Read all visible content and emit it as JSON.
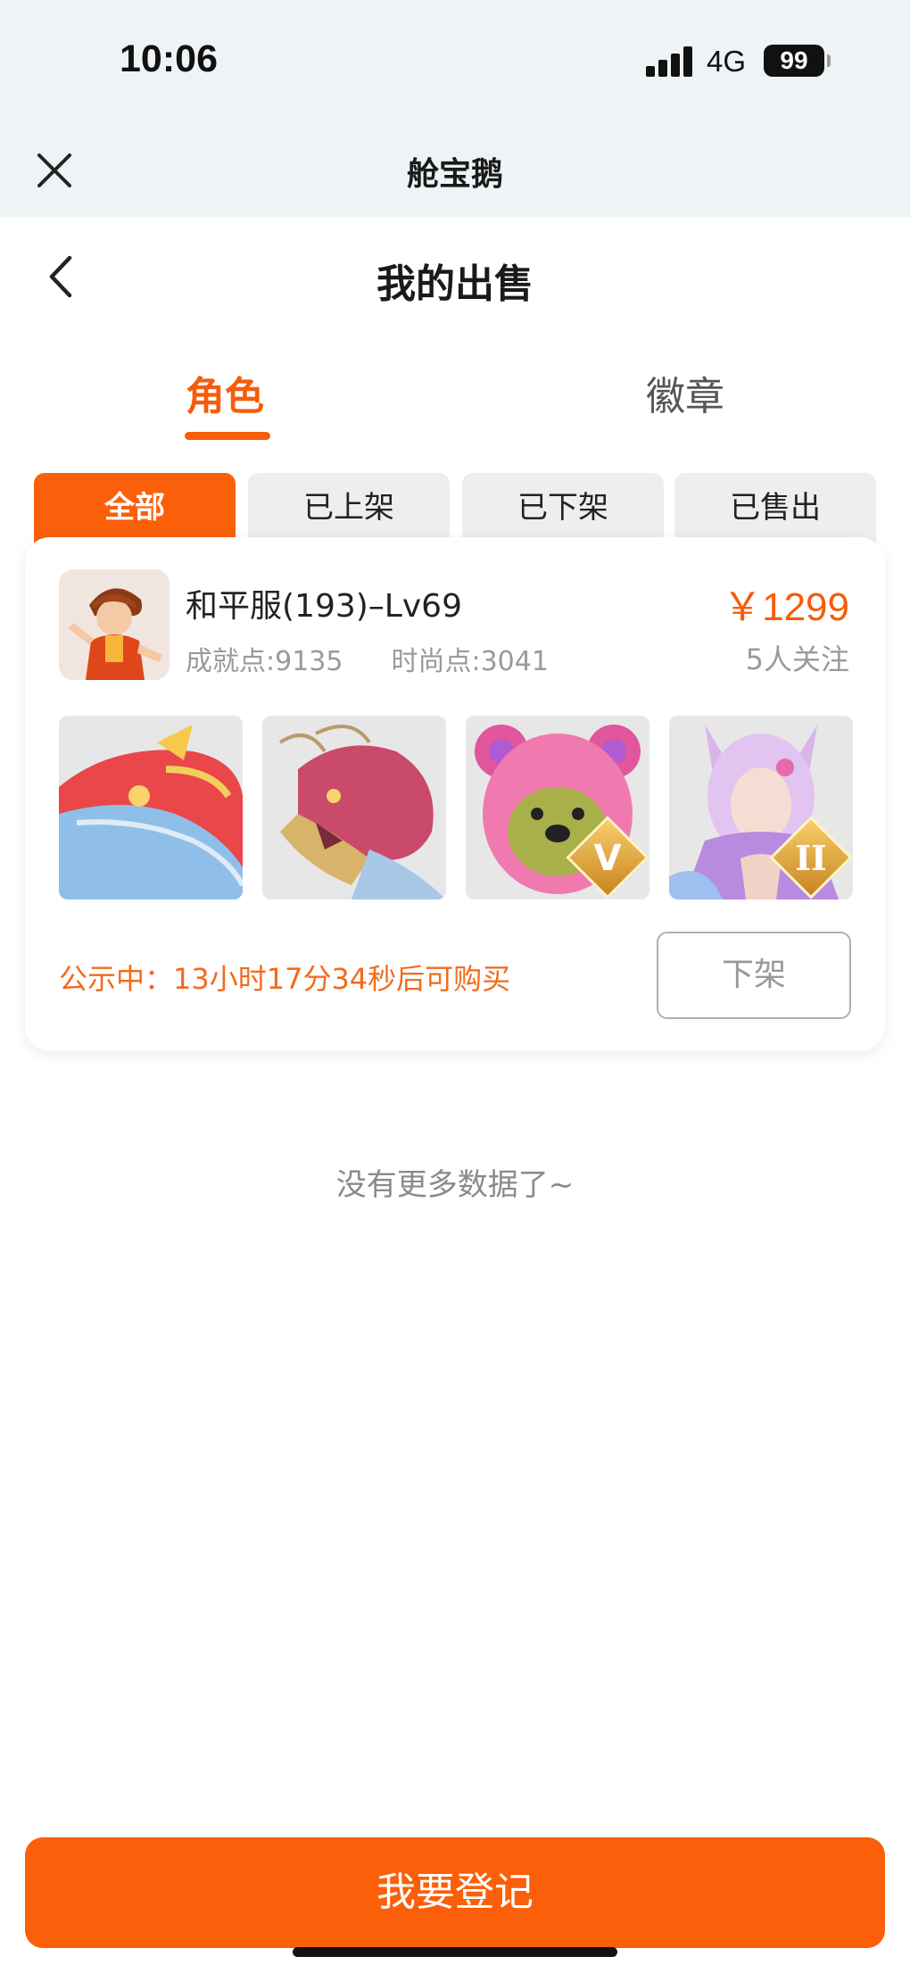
{
  "status_bar": {
    "time": "10:06",
    "network": "4G",
    "battery": "99"
  },
  "app": {
    "title": "舱宝鹅"
  },
  "page": {
    "title": "我的出售"
  },
  "tabs": [
    {
      "label": "角色",
      "active": true
    },
    {
      "label": "徽章",
      "active": false
    }
  ],
  "filters": [
    {
      "label": "全部",
      "active": true
    },
    {
      "label": "已上架",
      "active": false
    },
    {
      "label": "已下架",
      "active": false
    },
    {
      "label": "已售出",
      "active": false
    }
  ],
  "listing": {
    "name": "和平服(193)–Lv69",
    "achievement": "成就点:9135",
    "fashion": "时尚点:3041",
    "price": "￥1299",
    "watchers": "5人关注",
    "items": [
      {
        "icon": "shark-skin-icon"
      },
      {
        "icon": "dragon-skin-icon"
      },
      {
        "icon": "pink-bear-skin-icon",
        "badge": "V"
      },
      {
        "icon": "fox-girl-skin-icon",
        "badge": "II"
      }
    ],
    "notice": "公示中：13小时17分34秒后可购买",
    "delist_label": "下架"
  },
  "footer": {
    "no_more": "没有更多数据了~",
    "register_label": "我要登记"
  },
  "colors": {
    "accent": "#fb5f09",
    "chip_bg": "#eeeeee",
    "header_bg": "#eef4f6"
  }
}
